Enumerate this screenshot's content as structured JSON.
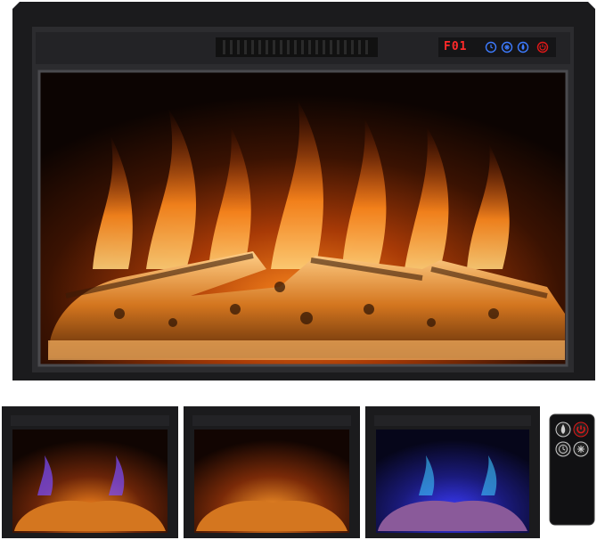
{
  "main_fireplace": {
    "display_text": "F01",
    "controls": [
      "timer-icon",
      "snowflake-icon",
      "flame-icon",
      "power-icon"
    ],
    "frame_color": "#1b1b1d",
    "panel_color": "#2c2c2f",
    "display_color": "#ff2a2a",
    "button_color": "#3d7bff"
  },
  "variants": [
    {
      "name": "orange-purple-flame",
      "flame_color": "#ff7a1a",
      "accent": "#7a4dff"
    },
    {
      "name": "orange-flame",
      "flame_color": "#ff7a1a",
      "accent": "#ffb04a"
    },
    {
      "name": "blue-flame",
      "flame_color": "#3b3bff",
      "accent": "#3cc7ff"
    }
  ],
  "remote": {
    "buttons": [
      "flame-icon",
      "power-icon",
      "timer-icon",
      "snowflake-icon"
    ],
    "body_color": "#111113",
    "power_color": "#e01818"
  }
}
